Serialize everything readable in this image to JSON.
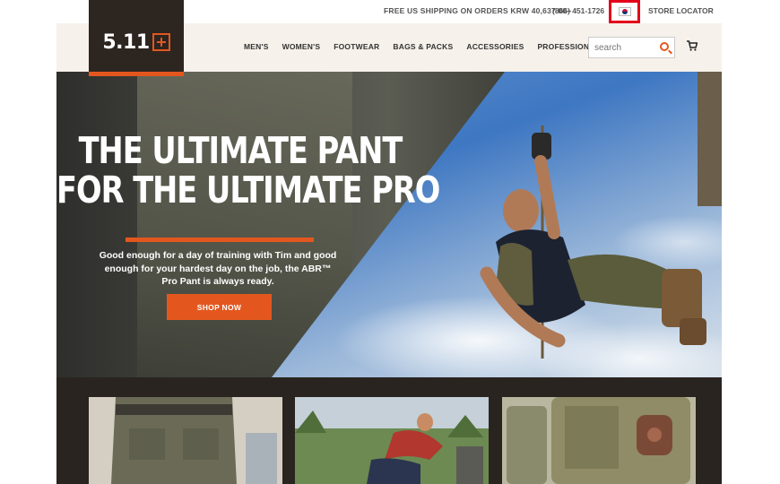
{
  "topbar": {
    "shipping": "FREE US SHIPPING ON ORDERS KRW 40,637.00+",
    "phone": "(866) 451-1726",
    "flag_icon": "south-korea-flag-icon",
    "store_locator": "STORE LOCATOR"
  },
  "logo": {
    "text": "5.11"
  },
  "nav": {
    "items": [
      "MEN'S",
      "WOMEN'S",
      "FOOTWEAR",
      "BAGS & PACKS",
      "ACCESSORIES",
      "PROFESSIONAL"
    ]
  },
  "search": {
    "placeholder": "search",
    "icon": "search-icon"
  },
  "cart": {
    "icon": "cart-icon"
  },
  "hero": {
    "headline_line1": "THE ULTIMATE PANT",
    "headline_line2": "FOR THE ULTIMATE PRO",
    "copy": "Good enough for a day of training with Tim and good enough for your hardest day on the job, the ABR™ Pro Pant is always ready.",
    "cta": "SHOP NOW"
  },
  "colors": {
    "accent": "#e3571f",
    "dark": "#2d2520",
    "header_bg": "#f6f1ea",
    "highlight_border": "#e3001b"
  }
}
